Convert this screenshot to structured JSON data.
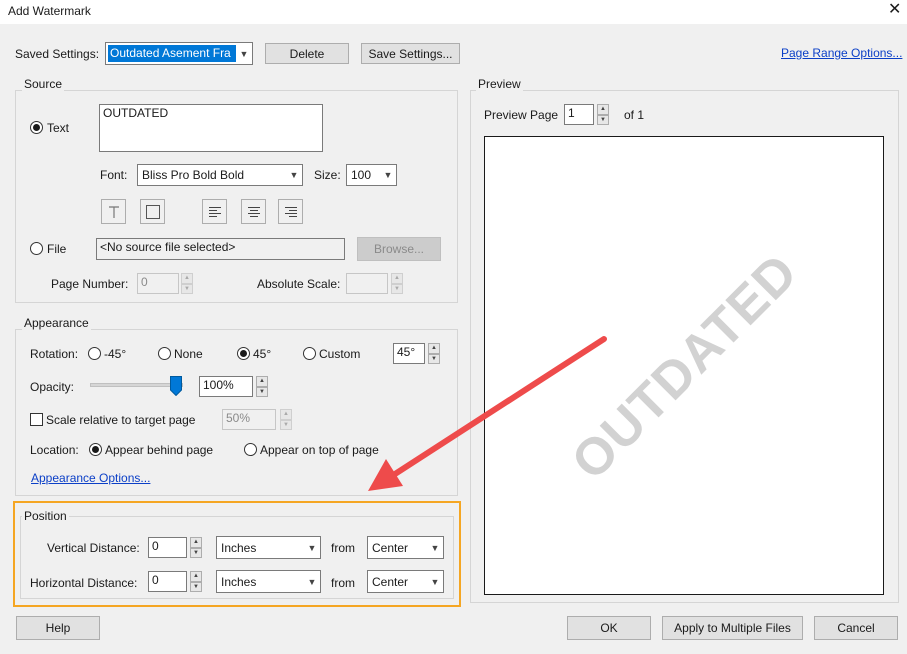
{
  "window": {
    "title": "Add Watermark"
  },
  "saved_settings": {
    "label": "Saved Settings:",
    "value": "Outdated Asement Fra",
    "delete_label": "Delete",
    "save_label": "Save Settings..."
  },
  "page_range_link": "Page Range Options...",
  "source": {
    "group_label": "Source",
    "text_radio_label": "Text",
    "text_value": "OUTDATED",
    "font_label": "Font:",
    "font_value": "Bliss Pro Bold Bold",
    "size_label": "Size:",
    "size_value": "100",
    "file_radio_label": "File",
    "file_value": "<No source file selected>",
    "browse_label": "Browse...",
    "page_number_label": "Page Number:",
    "page_number_value": "0",
    "absolute_scale_label": "Absolute Scale:",
    "absolute_scale_value": ""
  },
  "appearance": {
    "group_label": "Appearance",
    "rotation_label": "Rotation:",
    "rotation_options": [
      "-45°",
      "None",
      "45°",
      "Custom"
    ],
    "rotation_selected": "45°",
    "rotation_custom_value": "45°",
    "opacity_label": "Opacity:",
    "opacity_value": "100%",
    "opacity_fraction": 1.0,
    "scale_label": "Scale relative to target page",
    "scale_checked": false,
    "scale_value": "50%",
    "location_label": "Location:",
    "location_behind": "Appear behind page",
    "location_top": "Appear on top of page",
    "location_selected": "Appear behind page",
    "options_link": "Appearance Options..."
  },
  "position": {
    "group_label": "Position",
    "vertical_label": "Vertical Distance:",
    "vertical_value": "0",
    "vertical_unit": "Inches",
    "vertical_from_label": "from",
    "vertical_from": "Center",
    "horizontal_label": "Horizontal Distance:",
    "horizontal_value": "0",
    "horizontal_unit": "Inches",
    "horizontal_from_label": "from",
    "horizontal_from": "Center"
  },
  "preview": {
    "group_label": "Preview",
    "page_label": "Preview Page",
    "page_value": "1",
    "of_label": "of 1",
    "watermark_text": "OUTDATED"
  },
  "footer": {
    "help_label": "Help",
    "ok_label": "OK",
    "apply_multiple_label": "Apply to Multiple Files",
    "cancel_label": "Cancel"
  },
  "colors": {
    "highlight_box": "#f5a623",
    "arrow": "#ee4b4b",
    "link": "#0b3fc7",
    "selection": "#0078d7",
    "watermark": "#d2d2d2"
  }
}
